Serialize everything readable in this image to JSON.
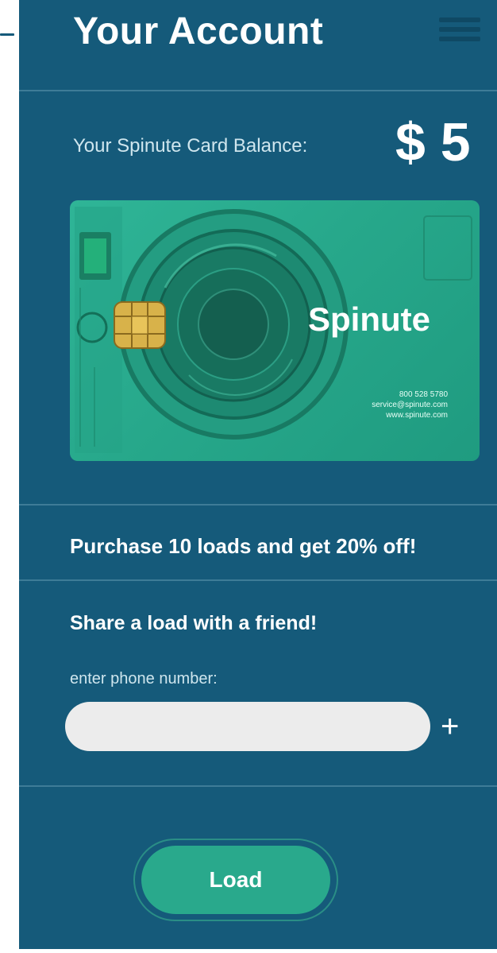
{
  "header": {
    "title": "Your Account"
  },
  "balance": {
    "label": "Your Spinute Card Balance:",
    "amount": "$ 5"
  },
  "card": {
    "brand": "Spinute",
    "phone": "800 528 5780",
    "email": "service@spinute.com",
    "website": "www.spinute.com"
  },
  "promo": {
    "text": "Purchase 10 loads and get 20% off!"
  },
  "share": {
    "title": "Share a load with a friend!",
    "phone_label": "enter phone number:",
    "phone_value": "",
    "add_symbol": "+"
  },
  "actions": {
    "load_label": "Load"
  },
  "colors": {
    "background": "#155a7a",
    "card_green": "#2fb597",
    "button_green": "#29a98c",
    "divider": "#3e7c97"
  }
}
